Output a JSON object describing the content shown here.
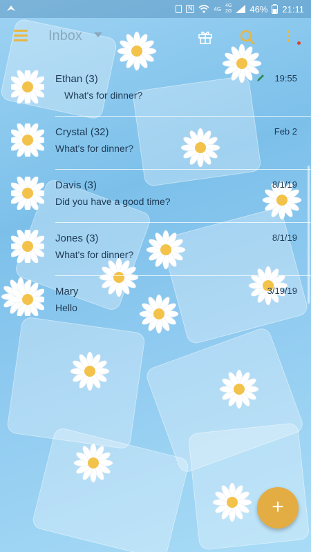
{
  "status_bar": {
    "network_labels": [
      "4G",
      "4G",
      "2G"
    ],
    "battery": "46%",
    "time": "21:11"
  },
  "app_bar": {
    "title": "Inbox",
    "icons": [
      "hamburger-menu-icon",
      "gift-icon",
      "search-icon",
      "more-vert-icon"
    ],
    "accent_color": "#e9b640"
  },
  "conversations": [
    {
      "name": "Ethan (3)",
      "snippet": "What's for dinner?",
      "time": "19:55",
      "draft": true
    },
    {
      "name": "Crystal (32)",
      "snippet": "What's for dinner?",
      "time": "Feb 2",
      "draft": false
    },
    {
      "name": "Davis (3)",
      "snippet": "Did you have a good time?",
      "time": "8/1/19",
      "draft": false
    },
    {
      "name": "Jones (3)",
      "snippet": "What's for dinner?",
      "time": "8/1/19",
      "draft": false
    },
    {
      "name": "Mary",
      "snippet": "Hello",
      "time": "3/19/19",
      "draft": false
    }
  ],
  "fab": {
    "label": "+",
    "color": "#e3ad44"
  }
}
